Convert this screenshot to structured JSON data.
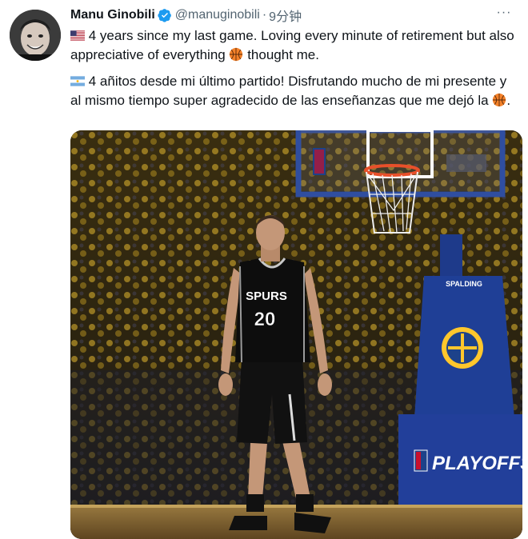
{
  "tweet": {
    "author_name": "Manu Ginobili",
    "handle": "@manuginobili",
    "separator": "·",
    "time": "9分钟",
    "more_label": "···",
    "text_en_1": "4 years since my last game. Loving every minute of retirement but also appreciative of everything",
    "text_en_2": "thought me.",
    "text_es_1": "4 añitos desde mi último partido! Disfrutando mucho de mi presente y al mismo tiempo super agradecido de las enseñanzas que me dejó la",
    "text_es_2": "."
  },
  "icons": {
    "verified": "verified-badge-icon",
    "flag_us": "us-flag-emoji",
    "flag_ar": "argentina-flag-emoji",
    "basketball": "basketball-emoji",
    "more": "more-options-icon"
  },
  "photo": {
    "jersey_team": "SPURS",
    "jersey_number": "20",
    "banner_brand": "SPALDING",
    "playoffs_label": "PLAYOFFS",
    "backboard_logo": "NBA"
  },
  "colors": {
    "verified": "#1d9bf0",
    "text": "#0f1419",
    "secondary": "#536471",
    "warriors_blue": "#1d428a",
    "warriors_gold": "#ffc72c"
  }
}
